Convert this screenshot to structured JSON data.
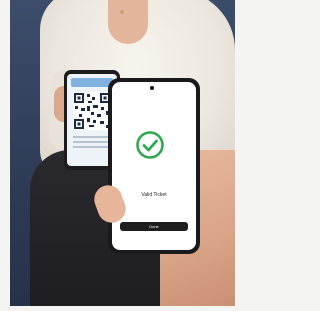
{
  "back_phone": {
    "screen": "qr-ticket"
  },
  "front_phone": {
    "status_icon": "check-circle-icon",
    "status_text": "Valid Ticket",
    "button_label": "Done",
    "accent_color": "#2fa84f"
  }
}
